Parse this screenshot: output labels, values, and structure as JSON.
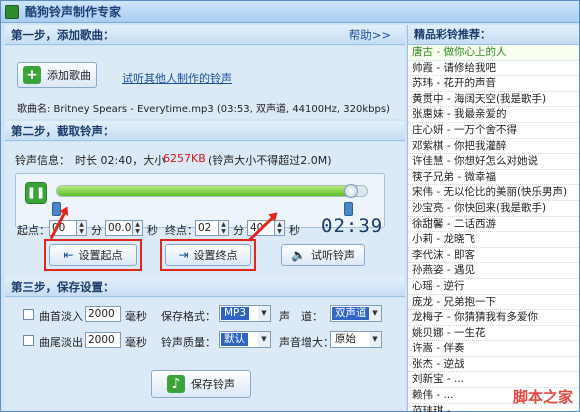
{
  "window": {
    "title": "酷狗铃声制作专家"
  },
  "step1": {
    "header": "第一步，添加歌曲：",
    "help": "帮助>>",
    "add_button": "添加歌曲",
    "others_link": "试听其他人制作的铃声",
    "song_info": "歌曲名: Britney Spears - Everytime.mp3 (03:53, 双声道, 44100Hz, 320kbps)"
  },
  "step2": {
    "header": "第二步，截取铃声：",
    "info_label": "铃声信息：",
    "info_text": "时长 02:40，大小",
    "size": "6257KB",
    "limit": "(铃声大小不得超过2.0M)",
    "play_icon": "pause-icon",
    "start_label": "起点：",
    "start_min": "00",
    "start_sec": "00.0",
    "end_label": "终点：",
    "end_min": "02",
    "end_sec": "40",
    "unit_min": "分",
    "unit_sec": "秒",
    "elapsed_display": "02:39",
    "set_start": "设置起点",
    "set_end": "设置终点",
    "preview": "试听铃声",
    "progress": 0.95,
    "start_frac": 0,
    "end_frac": 1
  },
  "step3": {
    "header": "第三步，保存设置：",
    "fade_in_label": "曲首淡入",
    "fade_in_value": "2000",
    "fade_out_label": "曲尾淡出",
    "fade_out_value": "2000",
    "ms": "毫秒",
    "format_label": "保存格式：",
    "format_value": "MP3",
    "channel_label": "声　道：",
    "channel_value": "双声道",
    "quality_label": "铃声质量：",
    "quality_value": "默认",
    "volume_label": "声音增大：",
    "volume_value": "原始",
    "save_button": "保存铃声"
  },
  "sidebar": {
    "header": "精品彩铃推荐：",
    "items": [
      "唐古 - 做你心上的人",
      "帅霞 - 请修给我吧",
      "苏玮 - 花开的声音",
      "黄贯中 - 海阔天空(我是歌手)",
      "张惠妹 - 我最亲爱的",
      "庄心妍 - 一万个舍不得",
      "邓紫棋 - 你把我灌醉",
      "许佳慧 - 你想好怎么对她说",
      "筷子兄弟 - 微幸福",
      "宋伟 - 无以伦比的美丽(快乐男声)",
      "沙宝亮 - 你快回来(我是歌手)",
      "徐甜馨 - 二话西游",
      "小莉 - 龙晓飞",
      "李代沫 - 即客",
      "孙燕姿 - 遇见",
      "心瑶 - 逆行",
      "庞龙 - 兄弟抱一下",
      "龙梅子 - 你猜猜我有多爱你",
      "姚贝娜 - 一生花",
      "许嵩 - 伴奏",
      "张杰 - 逆战",
      "刘新宝 - ...",
      "赖伟 - ...",
      "范玮琪 - ..."
    ]
  },
  "watermark": "脚本之家"
}
